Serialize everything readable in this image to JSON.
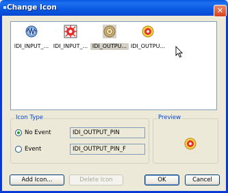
{
  "window": {
    "title": "Change Icon",
    "close_glyph": "✕",
    "title_mark": "¤"
  },
  "icon_list": {
    "items": [
      {
        "label": "IDI_INPUT_...",
        "icon": "input-wave-icon",
        "selected": false
      },
      {
        "label": "IDI_INPUT_...",
        "icon": "input-red-burst-icon",
        "selected": false
      },
      {
        "label": "IDI_OUTPU...",
        "icon": "output-pin-icon",
        "selected": true
      },
      {
        "label": "IDI_OUTPU...",
        "icon": "output-pin-f-icon",
        "selected": false
      }
    ]
  },
  "icon_type": {
    "title": "Icon Type",
    "options": [
      {
        "label": "No Event",
        "value": "IDI_OUTPUT_PIN",
        "checked": true
      },
      {
        "label": "Event",
        "value": "IDI_OUTPUT_PIN_F",
        "checked": false
      }
    ]
  },
  "preview": {
    "title": "Preview",
    "icon": "output-pin-f-icon"
  },
  "buttons": {
    "add_icon": "Add Icon...",
    "delete_icon": "Delete Icon",
    "ok": "OK",
    "cancel": "Cancel"
  },
  "colors": {
    "titlebar": "#0a58e0",
    "group_title": "#0046d5",
    "dialog_bg": "#ece9d8"
  }
}
